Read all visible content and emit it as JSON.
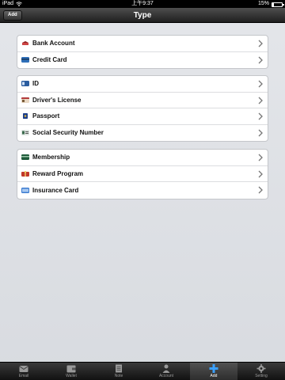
{
  "statusbar": {
    "device": "iPad",
    "time": "上午9:37",
    "battery": "15%",
    "battery_level": 0.15
  },
  "navbar": {
    "title": "Type",
    "add_label": "Add"
  },
  "groups": [
    {
      "items": [
        {
          "label": "Bank Account",
          "icon": "bank-icon"
        },
        {
          "label": "Credit Card",
          "icon": "credit-card-icon"
        }
      ]
    },
    {
      "items": [
        {
          "label": "ID",
          "icon": "id-card-icon"
        },
        {
          "label": "Driver's License",
          "icon": "driver-license-icon"
        },
        {
          "label": "Passport",
          "icon": "passport-icon"
        },
        {
          "label": "Social Security Number",
          "icon": "ssn-card-icon"
        }
      ]
    },
    {
      "items": [
        {
          "label": "Membership",
          "icon": "membership-card-icon"
        },
        {
          "label": "Reward Program",
          "icon": "reward-icon"
        },
        {
          "label": "Insurance Card",
          "icon": "insurance-card-icon"
        }
      ]
    }
  ],
  "tabs": [
    {
      "label": "Email",
      "icon": "mail-icon",
      "active": false
    },
    {
      "label": "Wallet",
      "icon": "wallet-icon",
      "active": false
    },
    {
      "label": "Note",
      "icon": "note-icon",
      "active": false
    },
    {
      "label": "Account",
      "icon": "person-icon",
      "active": false
    },
    {
      "label": "Add",
      "icon": "plus-icon",
      "active": true
    },
    {
      "label": "Setting",
      "icon": "gear-icon",
      "active": false
    }
  ]
}
